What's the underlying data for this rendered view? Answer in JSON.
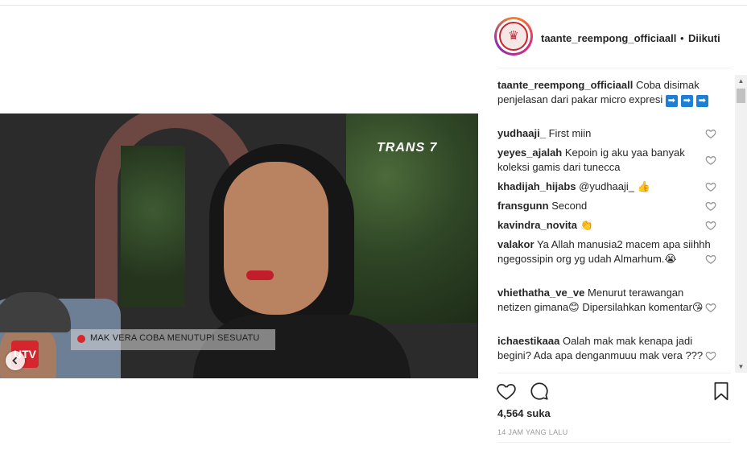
{
  "post": {
    "username": "taante_reempong_officiaall",
    "follow_separator": "•",
    "follow_label": "Diikuti"
  },
  "video": {
    "channel_logo": "TRANS 7",
    "caption": "MAK VERA COBA MENUTUPI SESUATU",
    "corner_logo": "UTV"
  },
  "caption": {
    "user": "taante_reempong_officiaall",
    "text": "Coba disimak penjelasan dari pakar micro expresi",
    "arrows": [
      "➡",
      "➡",
      "➡"
    ]
  },
  "comments": [
    {
      "user": "yudhaaji_",
      "text": "First miin"
    },
    {
      "user": "yeyes_ajalah",
      "text": "Kepoin ig aku yaa banyak koleksi gamis dari tunecca"
    },
    {
      "user": "khadijah_hijabs",
      "text": "@yudhaaji_ 👍"
    },
    {
      "user": "fransgunn",
      "text": "Second"
    },
    {
      "user": "kavindra_novita",
      "text": "👏"
    },
    {
      "user": "valakor",
      "text": "Ya Allah manusia2 macem apa siihhh ngegossipin org yg udah Almarhum.😭"
    },
    {
      "user": "vhiethatha_ve_ve",
      "text": "Menurut terawangan netizen gimana😊 Dipersilahkan komentar😘"
    },
    {
      "user": "ichaestikaaa",
      "text": "Oalah mak mak kenapa jadi begini? Ada apa denganmuuu mak vera ???"
    }
  ],
  "stats": {
    "likes": "4,564 suka",
    "time": "14 JAM YANG LALU"
  },
  "icons": {
    "like": "heart-icon",
    "comment": "comment-bubble-icon",
    "save": "bookmark-icon",
    "prev": "chevron-left-icon"
  }
}
